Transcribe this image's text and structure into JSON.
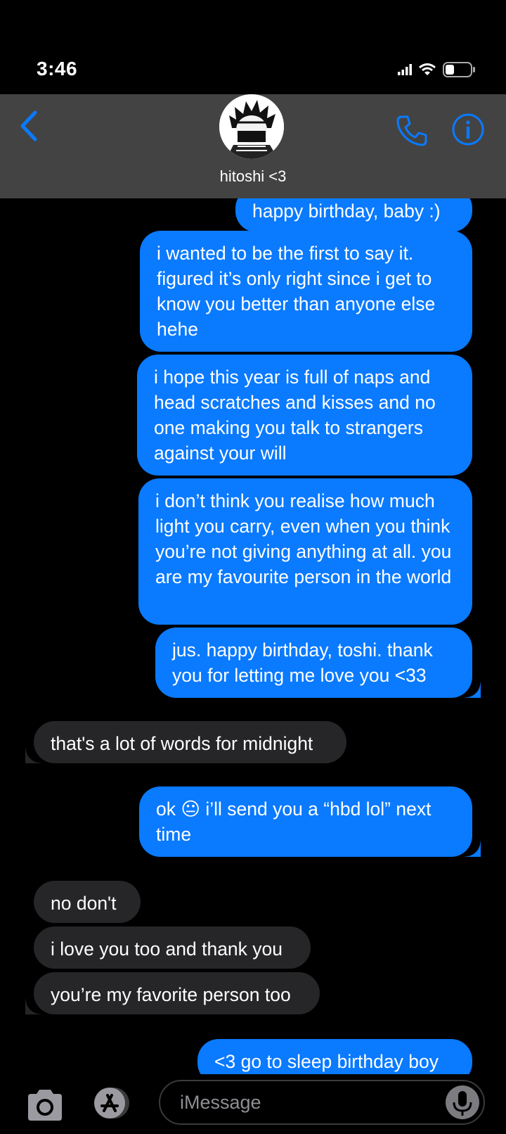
{
  "status_bar": {
    "time": "3:46"
  },
  "header": {
    "contact_name": "hitoshi <3"
  },
  "messages": [
    {
      "text": "happy birthday, baby :)"
    },
    {
      "text": "i wanted to be the first to say it. figured it’s only right since i get to know you better than anyone else hehe"
    },
    {
      "text": "i hope this year is full of naps and head scratches and kisses and no one making you talk to strangers against your will"
    },
    {
      "text": "i don’t think you realise how much light you carry, even when you think you’re not giving anything at all. you are my favourite person in the world"
    },
    {
      "text": "jus. happy birthday, toshi. thank you for letting me love you <33"
    },
    {
      "text": "that's a lot of words for midnight"
    },
    {
      "text": "ok 😐 i’ll send you a “hbd lol” next time"
    },
    {
      "text": "no don't"
    },
    {
      "text": "i love you too and thank you"
    },
    {
      "text": "you’re my favorite person too"
    },
    {
      "text": "<3 go to sleep birthday boy"
    }
  ],
  "input": {
    "placeholder": "iMessage"
  },
  "colors": {
    "accent": "#0a7aff",
    "sent_bubble": "#0a7aff",
    "received_bubble": "#262628",
    "header_bg": "#434343"
  }
}
